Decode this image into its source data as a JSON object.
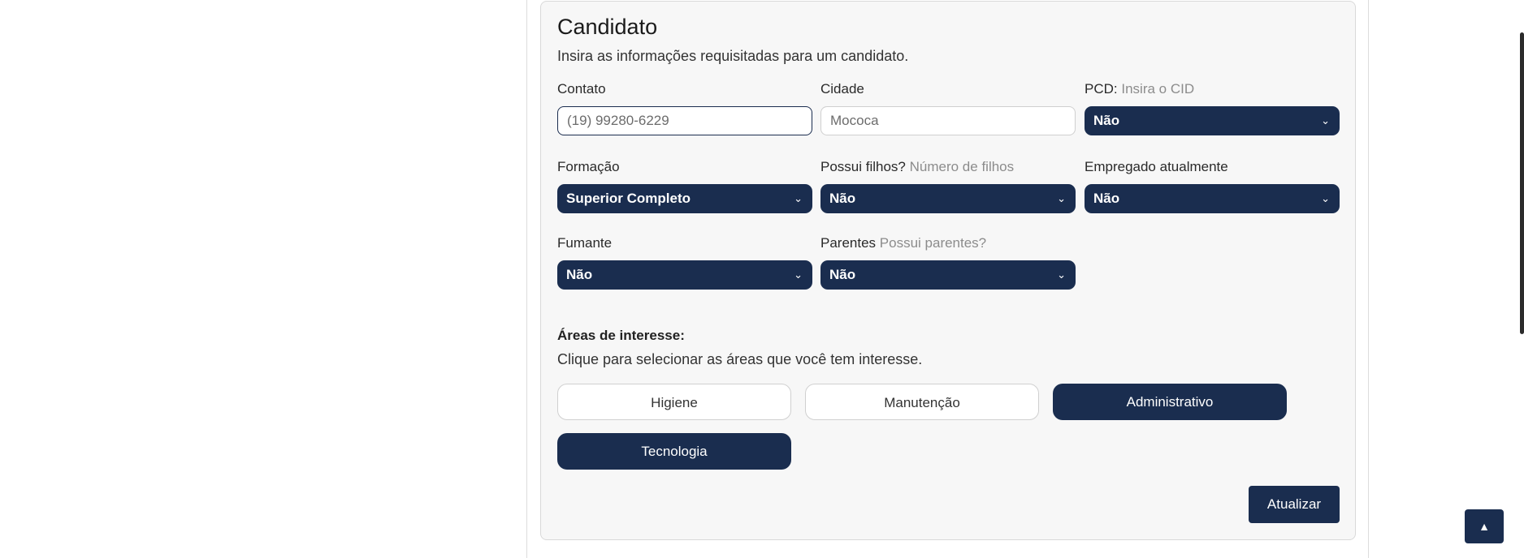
{
  "card": {
    "title": "Candidato",
    "subtitle": "Insira as informações requisitadas para um candidato."
  },
  "fields": {
    "contato": {
      "label": "Contato",
      "value": "(19) 99280-6229"
    },
    "cidade": {
      "label": "Cidade",
      "value": "Mococa"
    },
    "pcd": {
      "label": "PCD:",
      "hint": "Insira o CID",
      "value": "Não"
    },
    "formacao": {
      "label": "Formação",
      "value": "Superior Completo"
    },
    "filhos": {
      "label": "Possui filhos?",
      "hint": "Número de filhos",
      "value": "Não"
    },
    "empregado": {
      "label": "Empregado atualmente",
      "value": "Não"
    },
    "fumante": {
      "label": "Fumante",
      "value": "Não"
    },
    "parentes": {
      "label": "Parentes",
      "hint": "Possui parentes?",
      "value": "Não"
    }
  },
  "interests": {
    "title": "Áreas de interesse:",
    "subtitle": "Clique para selecionar as áreas que você tem interesse.",
    "options": [
      {
        "label": "Higiene",
        "selected": false
      },
      {
        "label": "Manutenção",
        "selected": false
      },
      {
        "label": "Administrativo",
        "selected": true
      },
      {
        "label": "Tecnologia",
        "selected": true
      }
    ]
  },
  "actions": {
    "update_label": "Atualizar",
    "scroll_top_icon": "chevron-up-icon"
  },
  "colors": {
    "primary": "#1a2d4f",
    "card_bg": "#f7f7f7"
  }
}
